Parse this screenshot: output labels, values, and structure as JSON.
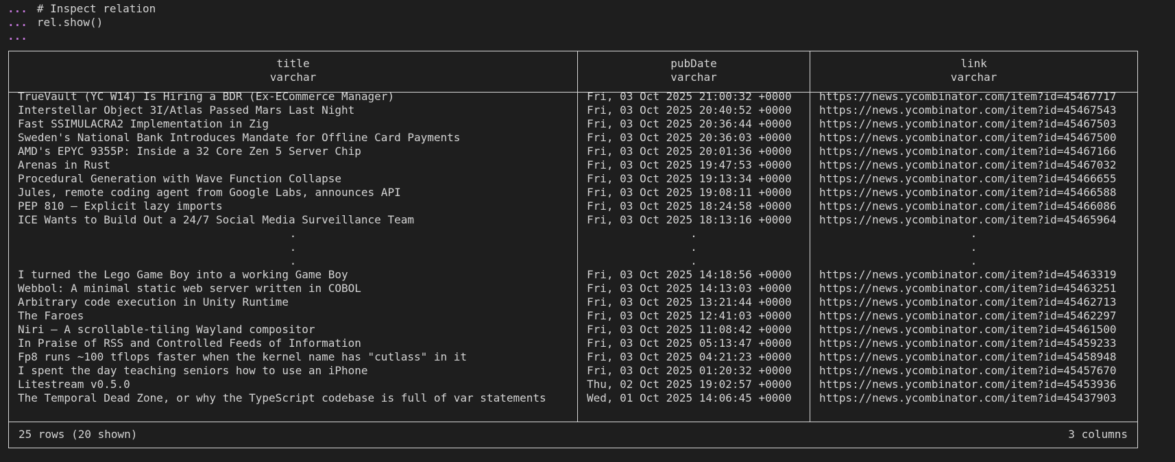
{
  "prompt": {
    "dots": "...",
    "lines": [
      "# Inspect relation",
      "rel.show()",
      ""
    ]
  },
  "table": {
    "columns": [
      {
        "name": "title",
        "type": "varchar"
      },
      {
        "name": "pubDate",
        "type": "varchar"
      },
      {
        "name": "link",
        "type": "varchar"
      }
    ],
    "rows_top": [
      [
        "TrueVault (YC W14) Is Hiring a BDR (Ex-ECommerce Manager)",
        "Fri, 03 Oct 2025 21:00:32 +0000",
        "https://news.ycombinator.com/item?id=45467717"
      ],
      [
        "Interstellar Object 3I/Atlas Passed Mars Last Night",
        "Fri, 03 Oct 2025 20:40:52 +0000",
        "https://news.ycombinator.com/item?id=45467543"
      ],
      [
        "Fast SSIMULACRA2 Implementation in Zig",
        "Fri, 03 Oct 2025 20:36:44 +0000",
        "https://news.ycombinator.com/item?id=45467503"
      ],
      [
        "Sweden's National Bank Introduces Mandate for Offline Card Payments",
        "Fri, 03 Oct 2025 20:36:03 +0000",
        "https://news.ycombinator.com/item?id=45467500"
      ],
      [
        "AMD's EPYC 9355P: Inside a 32 Core Zen 5 Server Chip",
        "Fri, 03 Oct 2025 20:01:36 +0000",
        "https://news.ycombinator.com/item?id=45467166"
      ],
      [
        "Arenas in Rust",
        "Fri, 03 Oct 2025 19:47:53 +0000",
        "https://news.ycombinator.com/item?id=45467032"
      ],
      [
        "Procedural Generation with Wave Function Collapse",
        "Fri, 03 Oct 2025 19:13:34 +0000",
        "https://news.ycombinator.com/item?id=45466655"
      ],
      [
        "Jules, remote coding agent from Google Labs, announces API",
        "Fri, 03 Oct 2025 19:08:11 +0000",
        "https://news.ycombinator.com/item?id=45466588"
      ],
      [
        "PEP 810 – Explicit lazy imports",
        "Fri, 03 Oct 2025 18:24:58 +0000",
        "https://news.ycombinator.com/item?id=45466086"
      ],
      [
        "ICE Wants to Build Out a 24/7 Social Media Surveillance Team",
        "Fri, 03 Oct 2025 18:13:16 +0000",
        "https://news.ycombinator.com/item?id=45465964"
      ]
    ],
    "ellipsis": ".",
    "rows_bottom": [
      [
        "I turned the Lego Game Boy into a working Game Boy",
        "Fri, 03 Oct 2025 14:18:56 +0000",
        "https://news.ycombinator.com/item?id=45463319"
      ],
      [
        "Webbol: A minimal static web server written in COBOL",
        "Fri, 03 Oct 2025 14:13:03 +0000",
        "https://news.ycombinator.com/item?id=45463251"
      ],
      [
        "Arbitrary code execution in Unity Runtime",
        "Fri, 03 Oct 2025 13:21:44 +0000",
        "https://news.ycombinator.com/item?id=45462713"
      ],
      [
        "The Faroes",
        "Fri, 03 Oct 2025 12:41:03 +0000",
        "https://news.ycombinator.com/item?id=45462297"
      ],
      [
        "Niri – A scrollable-tiling Wayland compositor",
        "Fri, 03 Oct 2025 11:08:42 +0000",
        "https://news.ycombinator.com/item?id=45461500"
      ],
      [
        "In Praise of RSS and Controlled Feeds of Information",
        "Fri, 03 Oct 2025 05:13:47 +0000",
        "https://news.ycombinator.com/item?id=45459233"
      ],
      [
        "Fp8 runs ~100 tflops faster when the kernel name has \"cutlass\" in it",
        "Fri, 03 Oct 2025 04:21:23 +0000",
        "https://news.ycombinator.com/item?id=45458948"
      ],
      [
        "I spent the day teaching seniors how to use an iPhone",
        "Fri, 03 Oct 2025 01:20:32 +0000",
        "https://news.ycombinator.com/item?id=45457670"
      ],
      [
        "Litestream v0.5.0",
        "Thu, 02 Oct 2025 19:02:57 +0000",
        "https://news.ycombinator.com/item?id=45453936"
      ],
      [
        "The Temporal Dead Zone, or why the TypeScript codebase is full of var statements",
        "Wed, 01 Oct 2025 14:06:45 +0000",
        "https://news.ycombinator.com/item?id=45437903"
      ]
    ],
    "footer": {
      "rows_text": "25 rows (20 shown)",
      "cols_text": "3 columns"
    }
  }
}
